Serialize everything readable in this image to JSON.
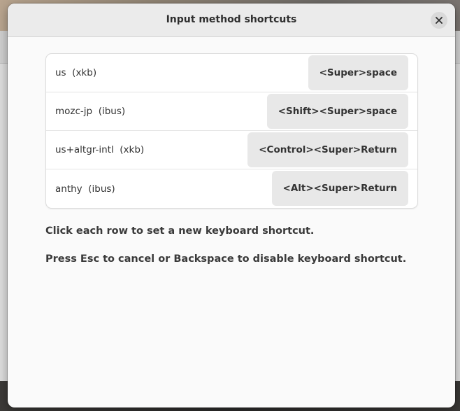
{
  "dialog": {
    "title": "Input method shortcuts",
    "close_icon": "close-icon"
  },
  "shortcuts": [
    {
      "name": "us",
      "source": "(xkb)",
      "label": "us  (xkb)",
      "shortcut": "<Super>space"
    },
    {
      "name": "mozc-jp",
      "source": "(ibus)",
      "label": "mozc-jp  (ibus)",
      "shortcut": "<Shift><Super>space"
    },
    {
      "name": "us+altgr-intl",
      "source": "(xkb)",
      "label": "us+altgr-intl  (xkb)",
      "shortcut": "<Control><Super>Return"
    },
    {
      "name": "anthy",
      "source": "(ibus)",
      "label": "anthy  (ibus)",
      "shortcut": "<Alt><Super>Return"
    }
  ],
  "hints": {
    "line1": "Click each row to set a new keyboard shortcut.",
    "line2": "Press Esc to cancel or Backspace to disable keyboard shortcut."
  },
  "colors": {
    "dialog_bg": "#fafafa",
    "header_bg": "#ebebeb",
    "shortcut_bg": "#e8e8e8",
    "text": "#333333"
  }
}
